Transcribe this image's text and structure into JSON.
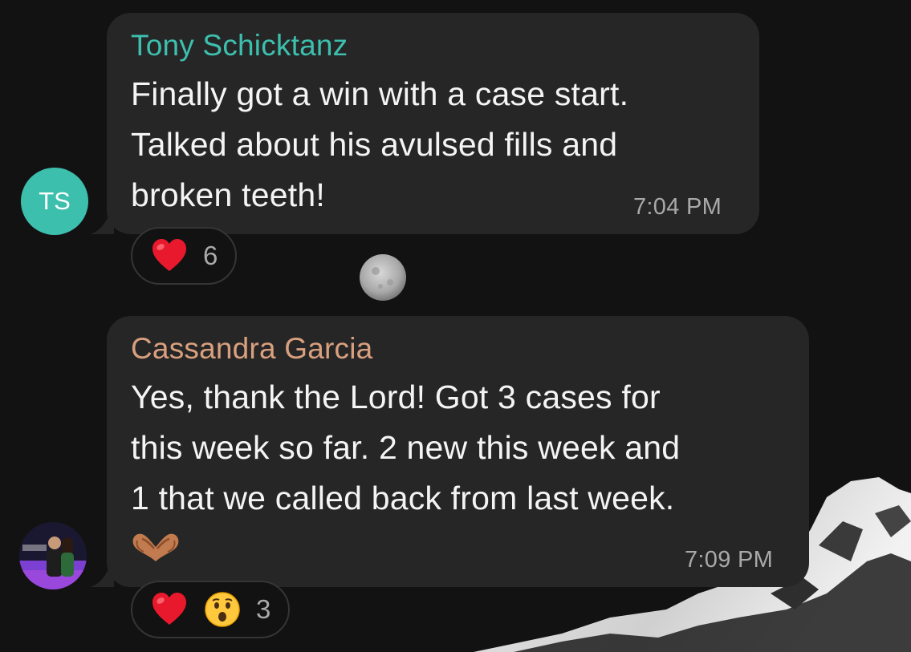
{
  "messages": [
    {
      "avatar_initials": "TS",
      "sender": "Tony Schicktanz",
      "sender_color": "#3dbfae",
      "lines": [
        "Finally got a win with a case start.",
        "Talked about his avulsed fills and",
        "broken teeth!"
      ],
      "time": "7:04 PM",
      "reactions": [
        {
          "icon": "red-heart-icon",
          "count": "6"
        }
      ]
    },
    {
      "avatar_type": "photo",
      "sender": "Cassandra Garcia",
      "sender_color": "#d9a07f",
      "lines": [
        "Yes, thank the Lord! Got 3 cases for",
        "this week so far. 2 new this week and",
        "1 that we called back from last week."
      ],
      "emoji_line": "heart-hands-icon",
      "time": "7:09 PM",
      "reactions": [
        {
          "icon": "red-heart-icon"
        },
        {
          "icon": "surprised-face-icon",
          "count": "3"
        }
      ]
    }
  ],
  "colors": {
    "background": "#121212",
    "bubble": "#262626",
    "time": "#a9a9a9",
    "text": "#f4f4f4"
  }
}
